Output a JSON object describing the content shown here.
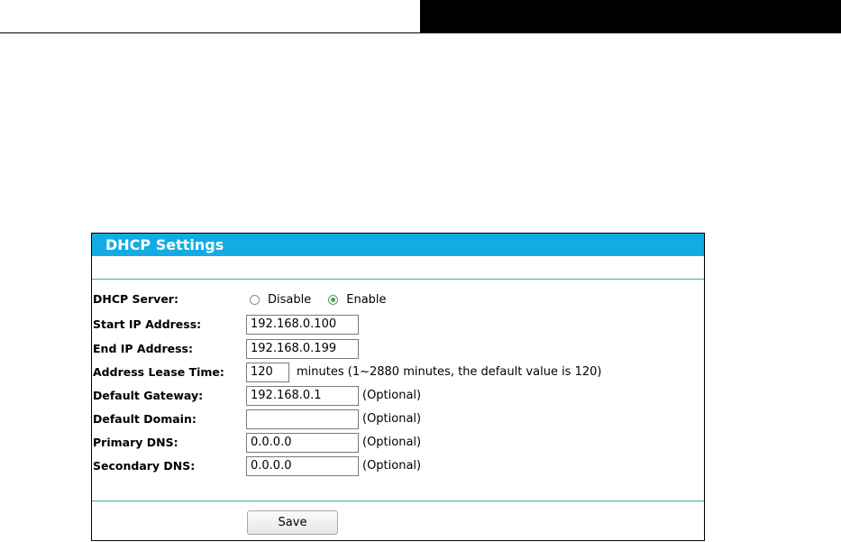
{
  "panel": {
    "title": "DHCP Settings"
  },
  "dhcp_server": {
    "label": "DHCP Server:",
    "options": [
      {
        "label": "Disable",
        "checked": false
      },
      {
        "label": "Enable",
        "checked": true
      }
    ]
  },
  "start_ip": {
    "label": "Start IP Address:",
    "value": "192.168.0.100"
  },
  "end_ip": {
    "label": "End IP Address:",
    "value": "192.168.0.199"
  },
  "lease_time": {
    "label": "Address Lease Time:",
    "value": "120",
    "note": "minutes (1~2880 minutes, the default value is 120)"
  },
  "gateway": {
    "label": "Default Gateway:",
    "value": "192.168.0.1",
    "note": "(Optional)"
  },
  "domain": {
    "label": "Default Domain:",
    "value": "",
    "note": "(Optional)"
  },
  "primary_dns": {
    "label": "Primary DNS:",
    "value": "0.0.0.0",
    "note": "(Optional)"
  },
  "secondary_dns": {
    "label": "Secondary DNS:",
    "value": "0.0.0.0",
    "note": "(Optional)"
  },
  "buttons": {
    "save": "Save"
  },
  "colors": {
    "header": "#12ace3",
    "divider": "#41a6a6",
    "radio_on": "#3fae3f"
  }
}
